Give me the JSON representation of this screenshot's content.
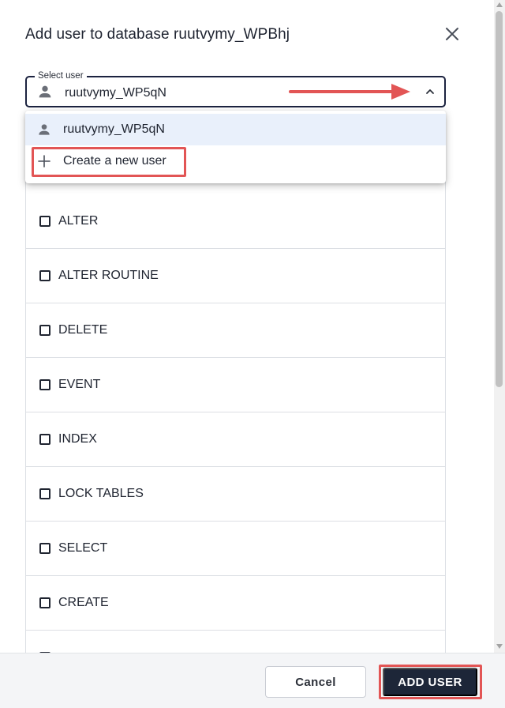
{
  "dialog": {
    "title": "Add user to database ruutvymy_WPBhj"
  },
  "select_user": {
    "label": "Select user",
    "value": "ruutvymy_WP5qN"
  },
  "dropdown": {
    "items": [
      {
        "label": "ruutvymy_WP5qN",
        "icon": "person-icon",
        "selected": true
      },
      {
        "label": "Create a new user",
        "icon": "plus-icon",
        "selected": false
      }
    ]
  },
  "privileges": [
    {
      "label": "ALTER",
      "checked": false
    },
    {
      "label": "ALTER ROUTINE",
      "checked": false
    },
    {
      "label": "DELETE",
      "checked": false
    },
    {
      "label": "EVENT",
      "checked": false
    },
    {
      "label": "INDEX",
      "checked": false
    },
    {
      "label": "LOCK TABLES",
      "checked": false
    },
    {
      "label": "SELECT",
      "checked": false
    },
    {
      "label": "CREATE",
      "checked": false
    }
  ],
  "footer": {
    "cancel_label": "Cancel",
    "add_label": "ADD USER"
  },
  "colors": {
    "primary": "#1d2638",
    "annotation": "#e25555",
    "selected_bg": "#e9f0fb"
  }
}
